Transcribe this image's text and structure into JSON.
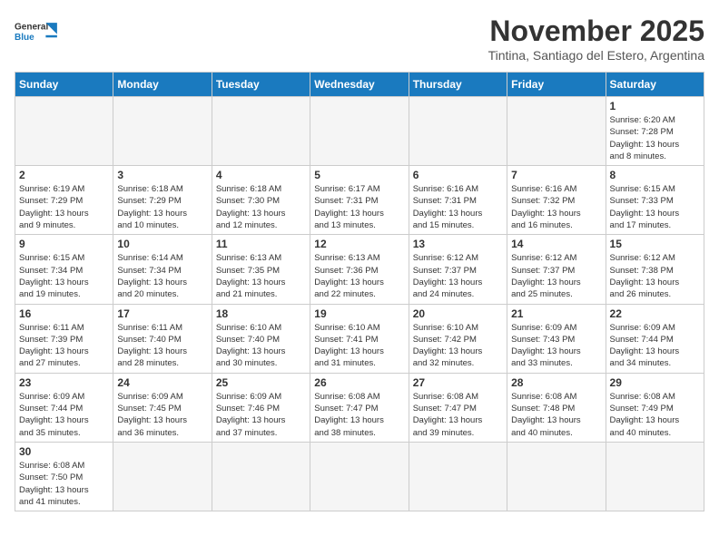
{
  "header": {
    "logo_general": "General",
    "logo_blue": "Blue",
    "month_title": "November 2025",
    "location": "Tintina, Santiago del Estero, Argentina"
  },
  "weekdays": [
    "Sunday",
    "Monday",
    "Tuesday",
    "Wednesday",
    "Thursday",
    "Friday",
    "Saturday"
  ],
  "weeks": [
    [
      {
        "day": "",
        "empty": true
      },
      {
        "day": "",
        "empty": true
      },
      {
        "day": "",
        "empty": true
      },
      {
        "day": "",
        "empty": true
      },
      {
        "day": "",
        "empty": true
      },
      {
        "day": "",
        "empty": true
      },
      {
        "day": "1",
        "sunrise": "6:20 AM",
        "sunset": "7:28 PM",
        "daylight": "13 hours and 8 minutes."
      }
    ],
    [
      {
        "day": "2",
        "sunrise": "6:19 AM",
        "sunset": "7:29 PM",
        "daylight": "13 hours and 9 minutes."
      },
      {
        "day": "3",
        "sunrise": "6:18 AM",
        "sunset": "7:29 PM",
        "daylight": "13 hours and 10 minutes."
      },
      {
        "day": "4",
        "sunrise": "6:18 AM",
        "sunset": "7:30 PM",
        "daylight": "13 hours and 12 minutes."
      },
      {
        "day": "5",
        "sunrise": "6:17 AM",
        "sunset": "7:31 PM",
        "daylight": "13 hours and 13 minutes."
      },
      {
        "day": "6",
        "sunrise": "6:16 AM",
        "sunset": "7:31 PM",
        "daylight": "13 hours and 15 minutes."
      },
      {
        "day": "7",
        "sunrise": "6:16 AM",
        "sunset": "7:32 PM",
        "daylight": "13 hours and 16 minutes."
      },
      {
        "day": "8",
        "sunrise": "6:15 AM",
        "sunset": "7:33 PM",
        "daylight": "13 hours and 17 minutes."
      }
    ],
    [
      {
        "day": "9",
        "sunrise": "6:15 AM",
        "sunset": "7:34 PM",
        "daylight": "13 hours and 19 minutes."
      },
      {
        "day": "10",
        "sunrise": "6:14 AM",
        "sunset": "7:34 PM",
        "daylight": "13 hours and 20 minutes."
      },
      {
        "day": "11",
        "sunrise": "6:13 AM",
        "sunset": "7:35 PM",
        "daylight": "13 hours and 21 minutes."
      },
      {
        "day": "12",
        "sunrise": "6:13 AM",
        "sunset": "7:36 PM",
        "daylight": "13 hours and 22 minutes."
      },
      {
        "day": "13",
        "sunrise": "6:12 AM",
        "sunset": "7:37 PM",
        "daylight": "13 hours and 24 minutes."
      },
      {
        "day": "14",
        "sunrise": "6:12 AM",
        "sunset": "7:37 PM",
        "daylight": "13 hours and 25 minutes."
      },
      {
        "day": "15",
        "sunrise": "6:12 AM",
        "sunset": "7:38 PM",
        "daylight": "13 hours and 26 minutes."
      }
    ],
    [
      {
        "day": "16",
        "sunrise": "6:11 AM",
        "sunset": "7:39 PM",
        "daylight": "13 hours and 27 minutes."
      },
      {
        "day": "17",
        "sunrise": "6:11 AM",
        "sunset": "7:40 PM",
        "daylight": "13 hours and 28 minutes."
      },
      {
        "day": "18",
        "sunrise": "6:10 AM",
        "sunset": "7:40 PM",
        "daylight": "13 hours and 30 minutes."
      },
      {
        "day": "19",
        "sunrise": "6:10 AM",
        "sunset": "7:41 PM",
        "daylight": "13 hours and 31 minutes."
      },
      {
        "day": "20",
        "sunrise": "6:10 AM",
        "sunset": "7:42 PM",
        "daylight": "13 hours and 32 minutes."
      },
      {
        "day": "21",
        "sunrise": "6:09 AM",
        "sunset": "7:43 PM",
        "daylight": "13 hours and 33 minutes."
      },
      {
        "day": "22",
        "sunrise": "6:09 AM",
        "sunset": "7:44 PM",
        "daylight": "13 hours and 34 minutes."
      }
    ],
    [
      {
        "day": "23",
        "sunrise": "6:09 AM",
        "sunset": "7:44 PM",
        "daylight": "13 hours and 35 minutes."
      },
      {
        "day": "24",
        "sunrise": "6:09 AM",
        "sunset": "7:45 PM",
        "daylight": "13 hours and 36 minutes."
      },
      {
        "day": "25",
        "sunrise": "6:09 AM",
        "sunset": "7:46 PM",
        "daylight": "13 hours and 37 minutes."
      },
      {
        "day": "26",
        "sunrise": "6:08 AM",
        "sunset": "7:47 PM",
        "daylight": "13 hours and 38 minutes."
      },
      {
        "day": "27",
        "sunrise": "6:08 AM",
        "sunset": "7:47 PM",
        "daylight": "13 hours and 39 minutes."
      },
      {
        "day": "28",
        "sunrise": "6:08 AM",
        "sunset": "7:48 PM",
        "daylight": "13 hours and 40 minutes."
      },
      {
        "day": "29",
        "sunrise": "6:08 AM",
        "sunset": "7:49 PM",
        "daylight": "13 hours and 40 minutes."
      }
    ],
    [
      {
        "day": "30",
        "sunrise": "6:08 AM",
        "sunset": "7:50 PM",
        "daylight": "13 hours and 41 minutes."
      },
      {
        "day": "",
        "empty": true
      },
      {
        "day": "",
        "empty": true
      },
      {
        "day": "",
        "empty": true
      },
      {
        "day": "",
        "empty": true
      },
      {
        "day": "",
        "empty": true
      },
      {
        "day": "",
        "empty": true
      }
    ]
  ],
  "labels": {
    "sunrise": "Sunrise:",
    "sunset": "Sunset:",
    "daylight": "Daylight:"
  }
}
